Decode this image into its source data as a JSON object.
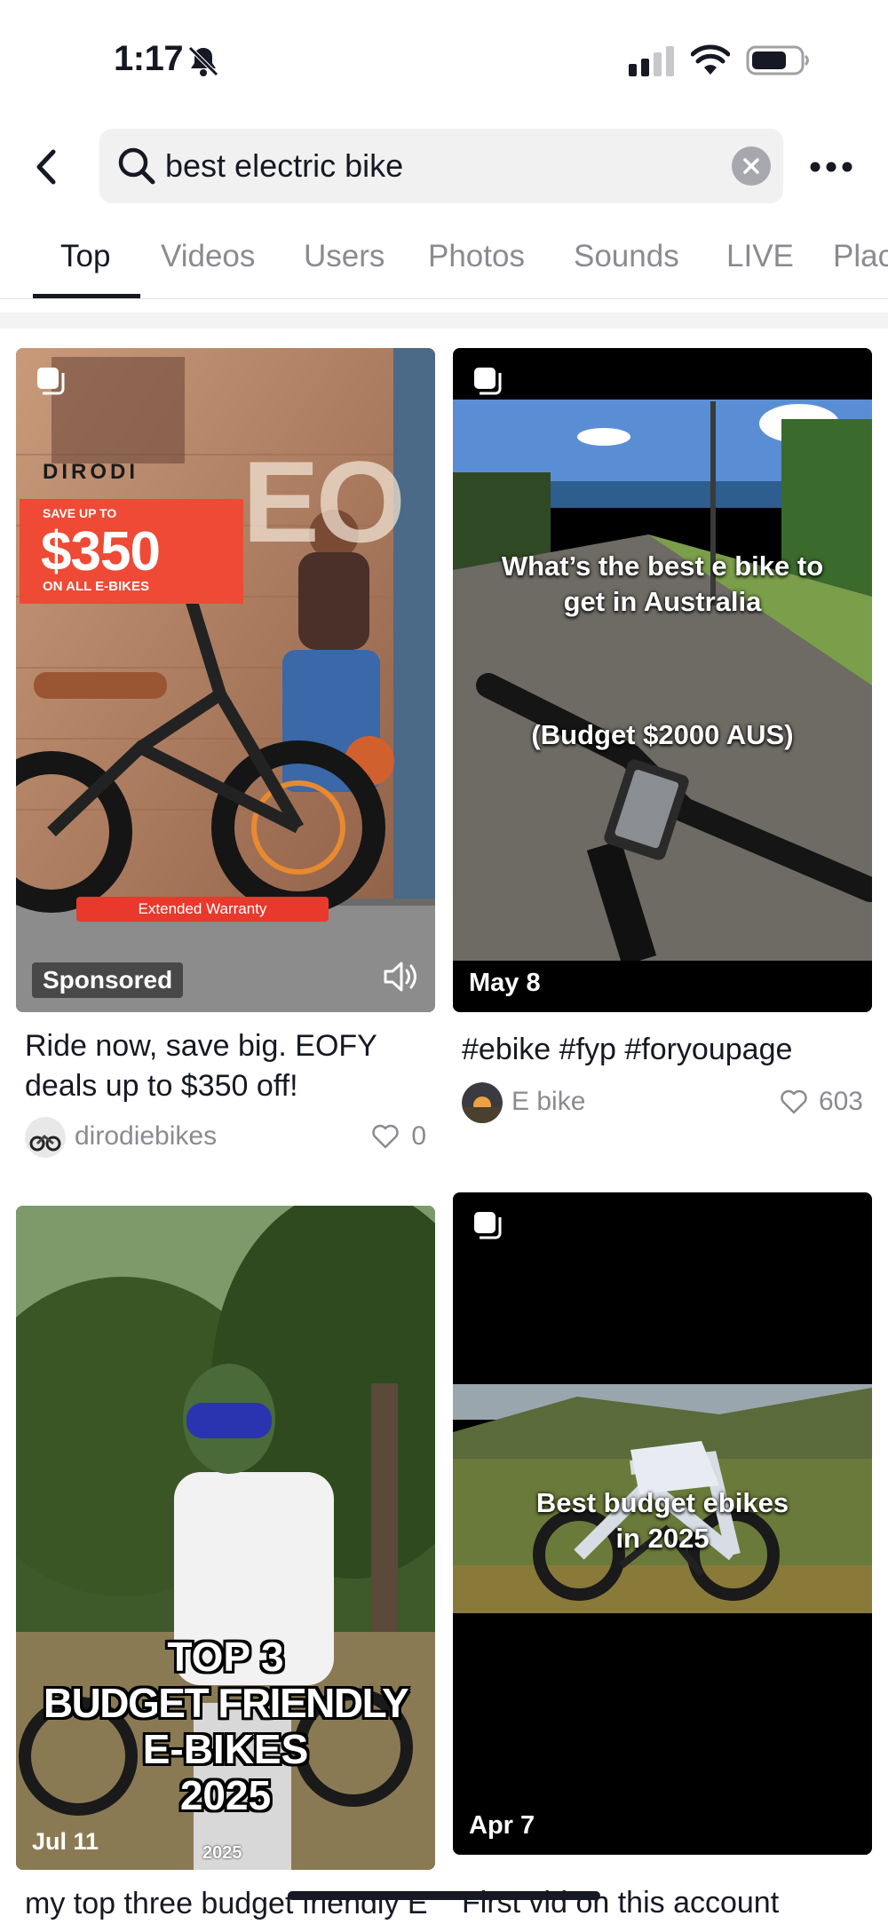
{
  "status_bar": {
    "time": "1:17"
  },
  "search": {
    "query": "best electric bike"
  },
  "tabs": [
    {
      "label": "Top"
    },
    {
      "label": "Videos"
    },
    {
      "label": "Users"
    },
    {
      "label": "Photos"
    },
    {
      "label": "Sounds"
    },
    {
      "label": "LIVE"
    },
    {
      "label": "Plac"
    }
  ],
  "videos": [
    {
      "overlay": {
        "brand": "DIRODI",
        "save_top": "SAVE UP TO",
        "amount": "$350",
        "save_bottom": "ON ALL E-BIKES",
        "warranty": "Extended Warranty",
        "big_letters": "EO"
      },
      "badge": "Sponsored",
      "caption": "Ride now, save big. EOFY deals up to $350 off!",
      "author": "dirodiebikes",
      "likes": "0"
    },
    {
      "overlay": {
        "line1": "What’s the best e bike to get in Australia",
        "line2": "(Budget $2000 AUS)"
      },
      "badge": "May 8",
      "caption": "#ebike #fyp #foryoupage",
      "author": "E bike",
      "likes": "603"
    },
    {
      "overlay": {
        "line1": "TOP 3",
        "line2": "BUDGET FRIENDLY",
        "line3": "E-BIKES",
        "line4": "2025",
        "shirt": "2025"
      },
      "badge": "Jul 11",
      "caption": "my top three budget friendly E bikes...",
      "author": "",
      "likes": ""
    },
    {
      "overlay": {
        "line1": "Best budget ebikes in 2025"
      },
      "badge": "Apr 7",
      "caption": "First vid on this account",
      "author": "",
      "likes": ""
    }
  ],
  "colors": {
    "sale_red": "#ee4a35",
    "warranty_red": "#e8392c",
    "text_primary": "#161823",
    "text_secondary": "#8a8b91"
  }
}
